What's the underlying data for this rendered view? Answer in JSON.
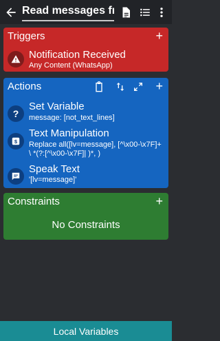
{
  "header": {
    "title": "Read messages fron",
    "back_icon": "arrow-left-icon",
    "doc_icon": "document-icon",
    "list_icon": "list-icon",
    "more_icon": "more-vertical-icon"
  },
  "triggers": {
    "title": "Triggers",
    "add": "+",
    "items": [
      {
        "icon": "warning-icon",
        "title": "Notification Received",
        "subtitle": "Any Content (WhatsApp)"
      }
    ],
    "color": "#c62828"
  },
  "actions": {
    "title": "Actions",
    "add": "+",
    "header_icons": [
      "clipboard-icon",
      "swap-vert-icon",
      "expand-icon"
    ],
    "items": [
      {
        "icon": "question-icon",
        "title": "Set Variable",
        "subtitle": "message: [not_text_lines]"
      },
      {
        "icon": "dollar-icon",
        "title": "Text Manipulation",
        "subtitle_lines": [
          "Replace all([lv=message], [^\\x00-\\x7F]+",
          "\\ *(?:[^\\x00-\\x7F]| )*,  )"
        ]
      },
      {
        "icon": "message-icon",
        "title": "Speak Text",
        "subtitle": "'[lv=message]'"
      }
    ],
    "color": "#1565c0"
  },
  "constraints": {
    "title": "Constraints",
    "add": "+",
    "empty_text": "No Constraints",
    "color": "#2e7d32"
  },
  "footer": {
    "label": "Local Variables"
  }
}
